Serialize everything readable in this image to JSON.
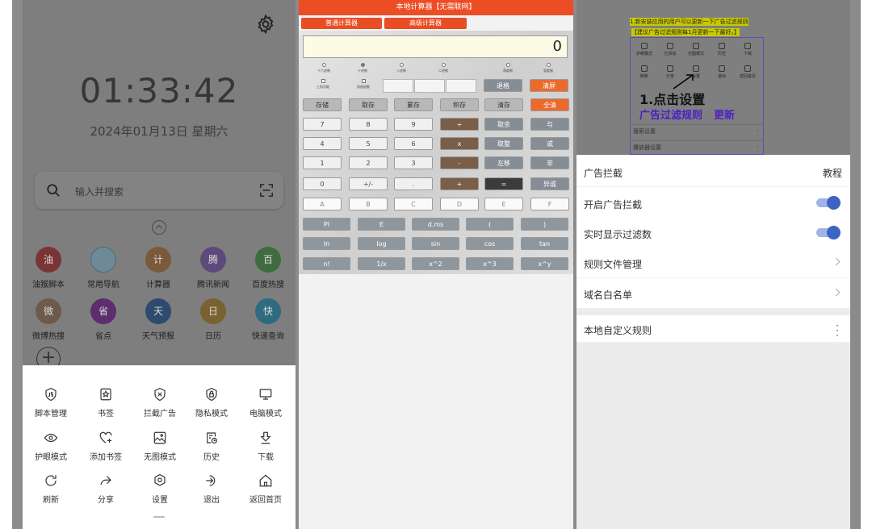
{
  "home": {
    "time": "01:33:42",
    "date": "2024年01月13日 星期六",
    "search_placeholder": "输入并搜索",
    "apps": [
      {
        "icon_char": "油",
        "label": "油猴脚本",
        "color": "#7a3434"
      },
      {
        "icon_char": "",
        "label": "常用导航",
        "color": "#6e8a96"
      },
      {
        "icon_char": "计",
        "label": "计算器",
        "color": "#7a5a3a"
      },
      {
        "icon_char": "腾",
        "label": "腾讯新闻",
        "color": "#5e4a7a"
      },
      {
        "icon_char": "百",
        "label": "百度热搜",
        "color": "#3f6b3f"
      },
      {
        "icon_char": "微",
        "label": "微博热搜",
        "color": "#6e5a4a"
      },
      {
        "icon_char": "省",
        "label": "省点",
        "color": "#5c2e6e"
      },
      {
        "icon_char": "天",
        "label": "天气预报",
        "color": "#2e4a6e"
      },
      {
        "icon_char": "日",
        "label": "日历",
        "color": "#7a6230"
      },
      {
        "icon_char": "快",
        "label": "快递查询",
        "color": "#2e6a80"
      }
    ],
    "menu": [
      {
        "label": "脚本管理",
        "icon": "js-script-icon"
      },
      {
        "label": "书签",
        "icon": "bookmark-icon"
      },
      {
        "label": "拦截广告",
        "icon": "shield-block-icon"
      },
      {
        "label": "隐私模式",
        "icon": "lock-icon"
      },
      {
        "label": "电脑模式",
        "icon": "monitor-icon"
      },
      {
        "label": "护眼模式",
        "icon": "eye-icon"
      },
      {
        "label": "添加书签",
        "icon": "heart-plus-icon"
      },
      {
        "label": "无图模式",
        "icon": "image-off-icon"
      },
      {
        "label": "历史",
        "icon": "history-icon"
      },
      {
        "label": "下载",
        "icon": "download-icon"
      },
      {
        "label": "刷新",
        "icon": "refresh-icon"
      },
      {
        "label": "分享",
        "icon": "share-icon"
      },
      {
        "label": "设置",
        "icon": "settings-icon"
      },
      {
        "label": "退出",
        "icon": "exit-icon"
      },
      {
        "label": "返回首页",
        "icon": "home-icon"
      }
    ]
  },
  "calc": {
    "title": "本地计算器【无需联网】",
    "tabs": [
      "普通计算器",
      "高级计算器"
    ],
    "display": "0",
    "radix": [
      "十六进制",
      "十进制",
      "八进制",
      "二进制",
      "角度制",
      "弧度制"
    ],
    "checks": [
      "上档功能",
      "双曲函数"
    ],
    "keys_top": [
      "退格",
      "清屏"
    ],
    "keys_mem": [
      "存储",
      "取存",
      "累存",
      "积存",
      "清存",
      "全清"
    ],
    "rows": [
      [
        "7",
        "8",
        "9",
        "÷",
        "取余",
        "与"
      ],
      [
        "4",
        "5",
        "6",
        "x",
        "取整",
        "或"
      ],
      [
        "1",
        "2",
        "3",
        "-",
        "左移",
        "非"
      ],
      [
        "0",
        "+/-",
        ".",
        "+",
        "=",
        "异或"
      ],
      [
        "A",
        "B",
        "C",
        "D",
        "E",
        "F"
      ]
    ],
    "sci": [
      [
        "PI",
        "E",
        "d.ms",
        "(",
        ")"
      ],
      [
        "ln",
        "log",
        "sin",
        "cos",
        "tan"
      ],
      [
        "n!",
        "1/x",
        "x^2",
        "x^3",
        "x^y"
      ]
    ]
  },
  "adblock": {
    "tip1": "1.新安装应用的用户可以更新一下广告过滤规则",
    "tip2": "【建议广告过滤规则每1月更新一下最好。】",
    "grid": [
      "护眼模式",
      "已添加",
      "无图模式",
      "历史",
      "下载",
      "刷新",
      "分享",
      "设置",
      "退出",
      "返回首页"
    ],
    "big1": "1.点击设置",
    "big2a": "广告过滤规则",
    "big2b": "更新",
    "mini_rows": [
      "搜索设置",
      "播放器设置"
    ],
    "header": "广告拦截",
    "header_right": "教程",
    "rows": [
      {
        "label": "开启广告拦截"
      },
      {
        "label": "实时显示过滤数"
      },
      {
        "label": "规则文件管理"
      },
      {
        "label": "域名白名单"
      }
    ],
    "custom": "本地自定义规则",
    "toggle_on_color": "#3d63c5"
  }
}
